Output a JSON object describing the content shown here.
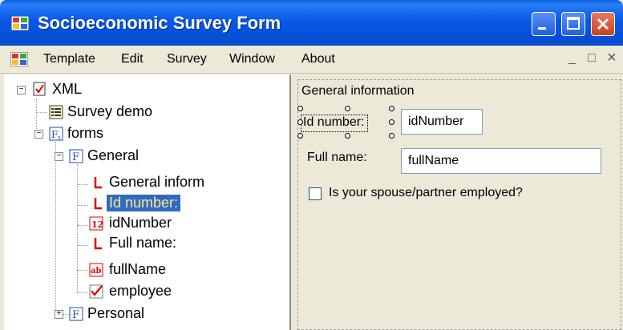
{
  "window": {
    "title": "Socioeconomic Survey Form"
  },
  "menu": {
    "items": [
      "Template",
      "Edit",
      "Survey",
      "Window",
      "About"
    ],
    "mdi_controls": {
      "minimize": "_",
      "restore": "□",
      "close": "×"
    }
  },
  "tree": {
    "root": "XML",
    "survey_demo": "Survey demo",
    "forms": "forms",
    "general": "General",
    "label_general_info": "General inform",
    "label_id_number": "Id number:",
    "field_id_number": "idNumber",
    "label_full_name": "Full name:",
    "field_full_name": "fullName",
    "field_employee": "employee",
    "personal": "Personal",
    "icons": {
      "xml": "document-check-icon",
      "survey": "list-icon",
      "forms": "forms-icon",
      "form": "form-f-icon",
      "label": "label-l-icon",
      "number": "number-12-icon",
      "text": "text-ab-icon",
      "check": "checkmark-icon"
    }
  },
  "designer": {
    "group_label": "General information",
    "id_label": "Id number:",
    "id_value": "idNumber",
    "fullname_label": "Full name:",
    "fullname_value": "fullName",
    "checkbox_label": "Is your spouse/partner employed?"
  },
  "colors": {
    "titlebar": "#0858e8",
    "selection": "#316ac5",
    "selection_text": "#ffe880"
  }
}
